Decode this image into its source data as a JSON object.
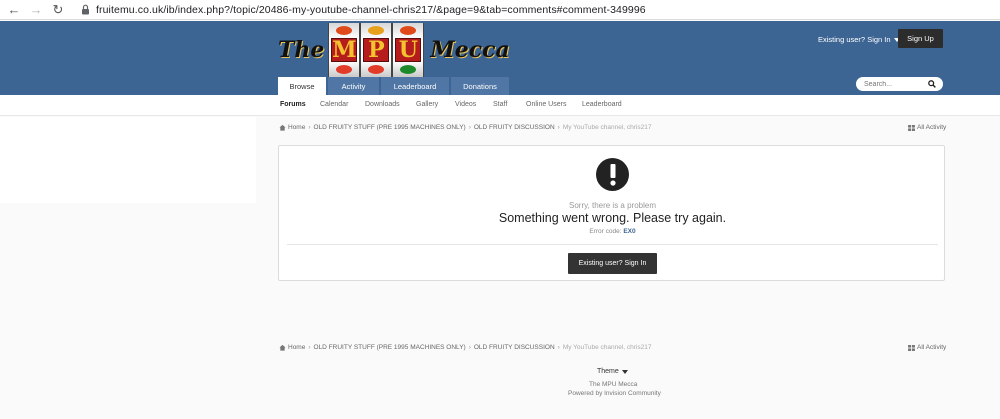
{
  "browser": {
    "url": "fruitemu.co.uk/ib/index.php?/topic/20486-my-youtube-channel-chris217/&page=9&tab=comments#comment-349996"
  },
  "header": {
    "logo_the": "The",
    "logo_reel_letters": [
      "M",
      "P",
      "U"
    ],
    "logo_mecca": "Mecca",
    "signin_label": "Existing user? Sign In",
    "signup_label": "Sign Up",
    "search_placeholder": "Search...",
    "tabs": [
      {
        "label": "Browse"
      },
      {
        "label": "Activity"
      },
      {
        "label": "Leaderboard"
      },
      {
        "label": "Donations"
      }
    ]
  },
  "subnav": {
    "items": [
      {
        "label": "Forums"
      },
      {
        "label": "Calendar"
      },
      {
        "label": "Downloads"
      },
      {
        "label": "Gallery"
      },
      {
        "label": "Videos"
      },
      {
        "label": "Staff"
      },
      {
        "label": "Online Users"
      },
      {
        "label": "Leaderboard"
      }
    ]
  },
  "breadcrumb": {
    "items": [
      "Home",
      "OLD FRUITY STUFF (PRE 1995 MACHINES ONLY)",
      "OLD FRUITY DISCUSSION",
      "My YouTube channel, chris217"
    ],
    "activity_label": "All Activity"
  },
  "error": {
    "title": "Sorry, there is a problem",
    "message": "Something went wrong. Please try again.",
    "code_label": "Error code:",
    "code": "EX0",
    "button_label": "Existing user? Sign In"
  },
  "footer": {
    "theme_label": "Theme",
    "site_name": "The MPU Mecca",
    "powered_by": "Powered by Invision Community"
  },
  "colors": {
    "header_bg": "#3d6594",
    "tab_bg": "#4f76a4",
    "dark_button": "#333333"
  }
}
